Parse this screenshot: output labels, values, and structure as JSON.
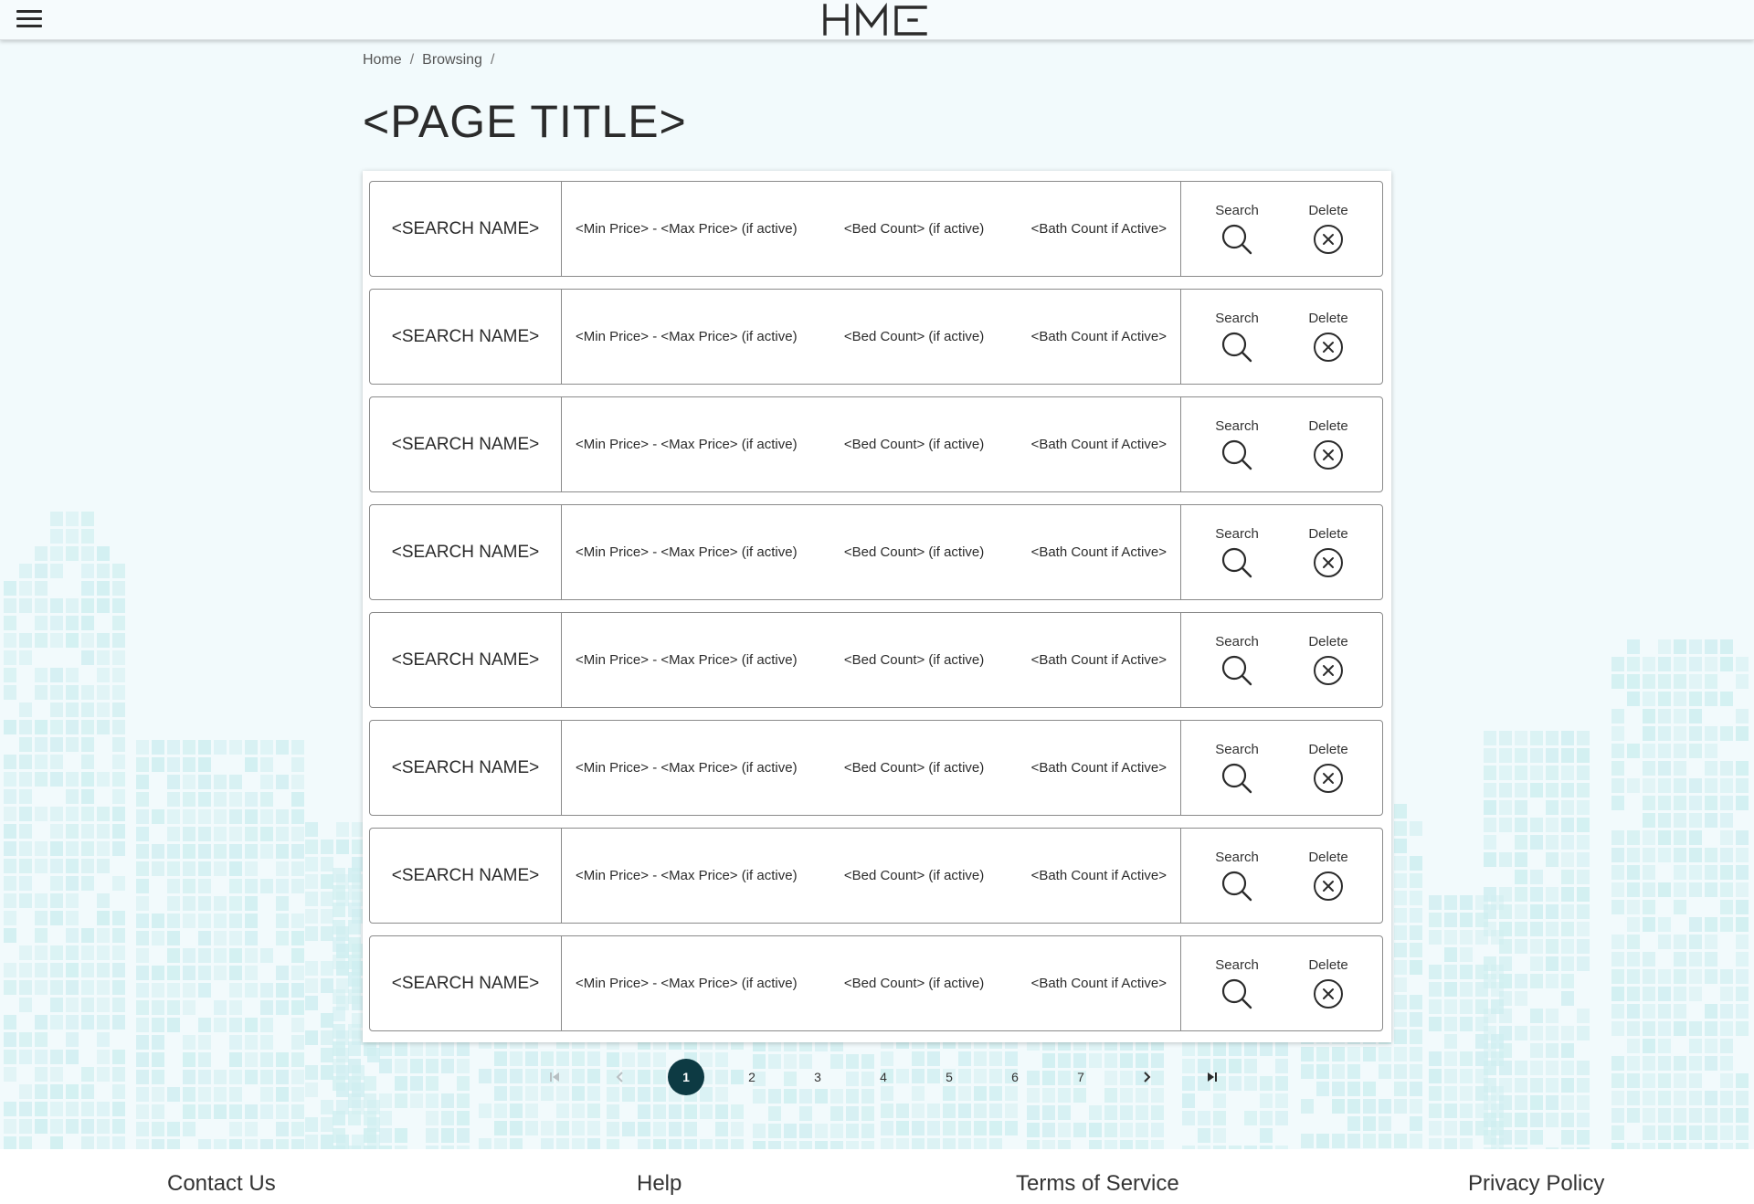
{
  "header": {
    "logo_text": "HME",
    "menu_icon": "hamburger-menu-icon"
  },
  "breadcrumb": [
    "Home",
    "Browsing"
  ],
  "breadcrumb_separator": "/",
  "page_title": "<PAGE TITLE>",
  "search_rows": [
    {
      "name": "<SEARCH NAME>",
      "price": "<Min Price> - <Max Price> (if active)",
      "beds": "<Bed Count> (if active)",
      "baths": "<Bath Count if Active>",
      "search_label": "Search",
      "delete_label": "Delete"
    },
    {
      "name": "<SEARCH NAME>",
      "price": "<Min Price> - <Max Price> (if active)",
      "beds": "<Bed Count> (if active)",
      "baths": "<Bath Count if Active>",
      "search_label": "Search",
      "delete_label": "Delete"
    },
    {
      "name": "<SEARCH NAME>",
      "price": "<Min Price> - <Max Price> (if active)",
      "beds": "<Bed Count> (if active)",
      "baths": "<Bath Count if Active>",
      "search_label": "Search",
      "delete_label": "Delete"
    },
    {
      "name": "<SEARCH NAME>",
      "price": "<Min Price> - <Max Price> (if active)",
      "beds": "<Bed Count> (if active)",
      "baths": "<Bath Count if Active>",
      "search_label": "Search",
      "delete_label": "Delete"
    },
    {
      "name": "<SEARCH NAME>",
      "price": "<Min Price> - <Max Price> (if active)",
      "beds": "<Bed Count> (if active)",
      "baths": "<Bath Count if Active>",
      "search_label": "Search",
      "delete_label": "Delete"
    },
    {
      "name": "<SEARCH NAME>",
      "price": "<Min Price> - <Max Price> (if active)",
      "beds": "<Bed Count> (if active)",
      "baths": "<Bath Count if Active>",
      "search_label": "Search",
      "delete_label": "Delete"
    },
    {
      "name": "<SEARCH NAME>",
      "price": "<Min Price> - <Max Price> (if active)",
      "beds": "<Bed Count> (if active)",
      "baths": "<Bath Count if Active>",
      "search_label": "Search",
      "delete_label": "Delete"
    },
    {
      "name": "<SEARCH NAME>",
      "price": "<Min Price> - <Max Price> (if active)",
      "beds": "<Bed Count> (if active)",
      "baths": "<Bath Count if Active>",
      "search_label": "Search",
      "delete_label": "Delete"
    }
  ],
  "pagination": {
    "pages": [
      "1",
      "2",
      "3",
      "4",
      "5",
      "6",
      "7"
    ],
    "current": "1",
    "first_icon": "first-page-icon",
    "prev_icon": "chevron-left-icon",
    "next_icon": "chevron-right-icon",
    "last_icon": "last-page-icon"
  },
  "footer": {
    "contact": "Contact Us",
    "help": "Help",
    "terms": "Terms of Service",
    "privacy": "Privacy Policy"
  },
  "colors": {
    "background": "#f2fafc",
    "accent": "#0d3a43",
    "skyline": "#cfeef0",
    "border": "#8a8a8a"
  }
}
